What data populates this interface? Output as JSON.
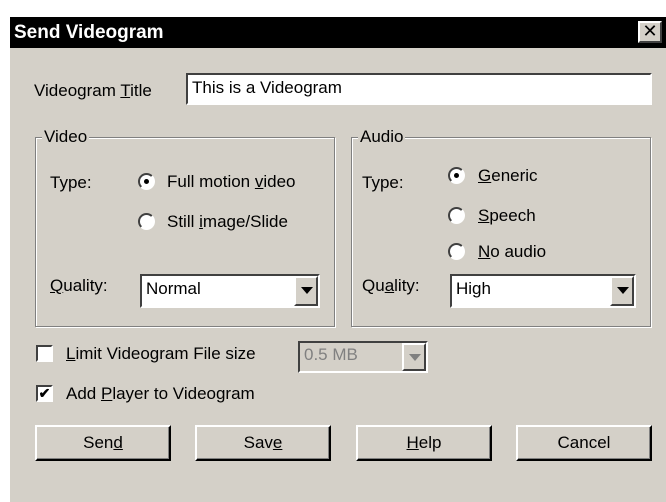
{
  "dialog": {
    "title": "Send Videogram",
    "close_glyph": "✕"
  },
  "title_field": {
    "label_pre": "Videogram ",
    "label_u": "T",
    "label_post": "itle",
    "value": "This is a Videogram"
  },
  "video": {
    "group_title": "Video",
    "type_label": "Type:",
    "options": [
      {
        "pre": "Full motion ",
        "u": "v",
        "post": "ideo",
        "selected": true
      },
      {
        "pre": "Still ",
        "u": "i",
        "post": "mage/Slide",
        "selected": false
      }
    ],
    "quality_label_u": "Q",
    "quality_label_post": "uality:",
    "quality_value": "Normal"
  },
  "audio": {
    "group_title": "Audio",
    "type_label": "Type:",
    "options": [
      {
        "pre": "",
        "u": "G",
        "post": "eneric",
        "selected": true
      },
      {
        "pre": "",
        "u": "S",
        "post": "peech",
        "selected": false
      },
      {
        "pre": "",
        "u": "N",
        "post": "o audio",
        "selected": false
      }
    ],
    "quality_label_pre": "Qu",
    "quality_label_u": "a",
    "quality_label_post": "lity:",
    "quality_value": "High"
  },
  "limit_size": {
    "label_u": "L",
    "label_post": "imit Videogram File size",
    "checked": false,
    "size_value": "0.5 MB"
  },
  "add_player": {
    "label_pre": "Add ",
    "label_u": "P",
    "label_post": "layer to Videogram",
    "checked": true,
    "check_glyph": "✔"
  },
  "buttons": {
    "send": {
      "pre": "Sen",
      "u": "d",
      "post": ""
    },
    "save": {
      "pre": "Sav",
      "u": "e",
      "post": ""
    },
    "help": {
      "pre": "",
      "u": "H",
      "post": "elp"
    },
    "cancel": {
      "label": "Cancel"
    }
  },
  "colors": {
    "face": "#d4d0c8",
    "titlebar": "#000000"
  }
}
